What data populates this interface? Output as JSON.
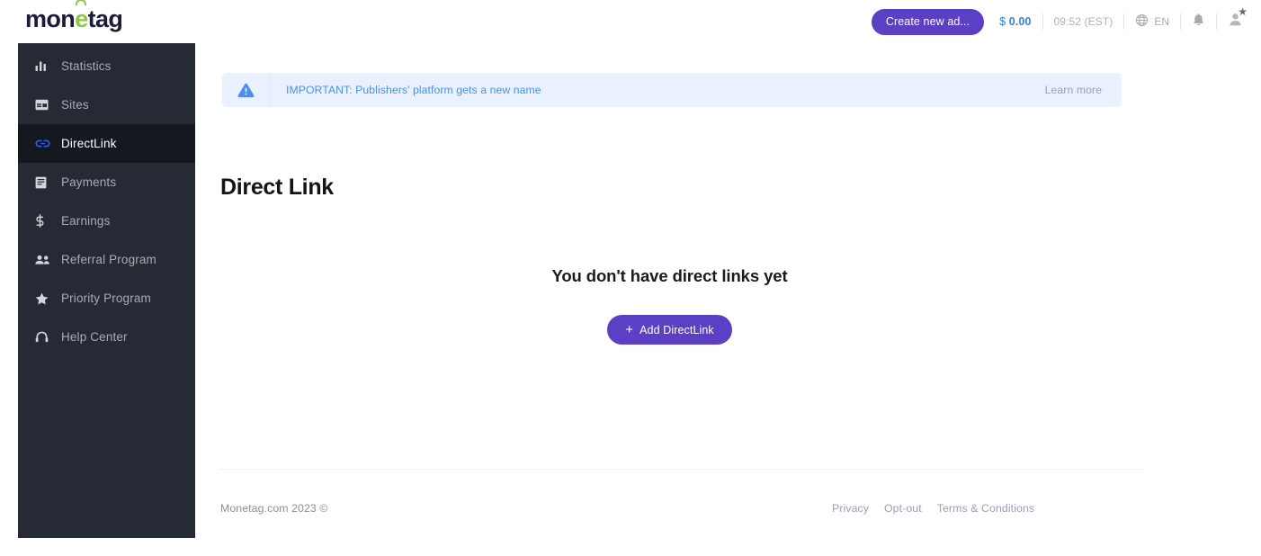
{
  "brand": {
    "logo_prefix": "mon",
    "logo_accent_letter": "e",
    "logo_suffix": "tag",
    "accent_green": "#8cc63f",
    "logo_navy": "#1d1b3c",
    "primary_purple": "#5b3fc4",
    "link_blue": "#2f80ed",
    "sidebar_bg": "#252a34",
    "sidebar_active_bg": "#15181f",
    "active_icon_blue": "#3d5afe"
  },
  "topbar": {
    "create_ad_label": "Create new ad...",
    "balance_currency": "$",
    "balance_value": "0.00",
    "clock": "09:52 (EST)",
    "language": "EN",
    "globe_icon": "globe-icon",
    "bell_icon": "bell-icon",
    "avatar_icon": "user-avatar-icon",
    "avatar_badge_icon": "star-badge-icon"
  },
  "sidebar": {
    "items": [
      {
        "label": "Statistics",
        "icon": "bar-chart-icon",
        "active": false
      },
      {
        "label": "Sites",
        "icon": "layout-icon",
        "active": false
      },
      {
        "label": "DirectLink",
        "icon": "link-chain-icon",
        "active": true
      },
      {
        "label": "Payments",
        "icon": "document-icon",
        "active": false
      },
      {
        "label": "Earnings",
        "icon": "dollar-sign-icon",
        "active": false
      },
      {
        "label": "Referral Program",
        "icon": "people-icon",
        "active": false
      },
      {
        "label": "Priority Program",
        "icon": "star-icon",
        "active": false
      },
      {
        "label": "Help Center",
        "icon": "headset-icon",
        "active": false
      }
    ]
  },
  "banner": {
    "icon": "warning-triangle-icon",
    "text": "IMPORTANT: Publishers' platform gets a new name",
    "link_label": "Learn more"
  },
  "main": {
    "page_title": "Direct Link",
    "empty_state": {
      "message": "You don't have direct links yet",
      "button_label": "Add DirectLink",
      "button_plus": "+"
    }
  },
  "footer": {
    "copyright": "Monetag.com 2023 ©",
    "links": [
      {
        "label": "Privacy"
      },
      {
        "label": "Opt-out"
      },
      {
        "label": "Terms & Conditions"
      }
    ]
  }
}
